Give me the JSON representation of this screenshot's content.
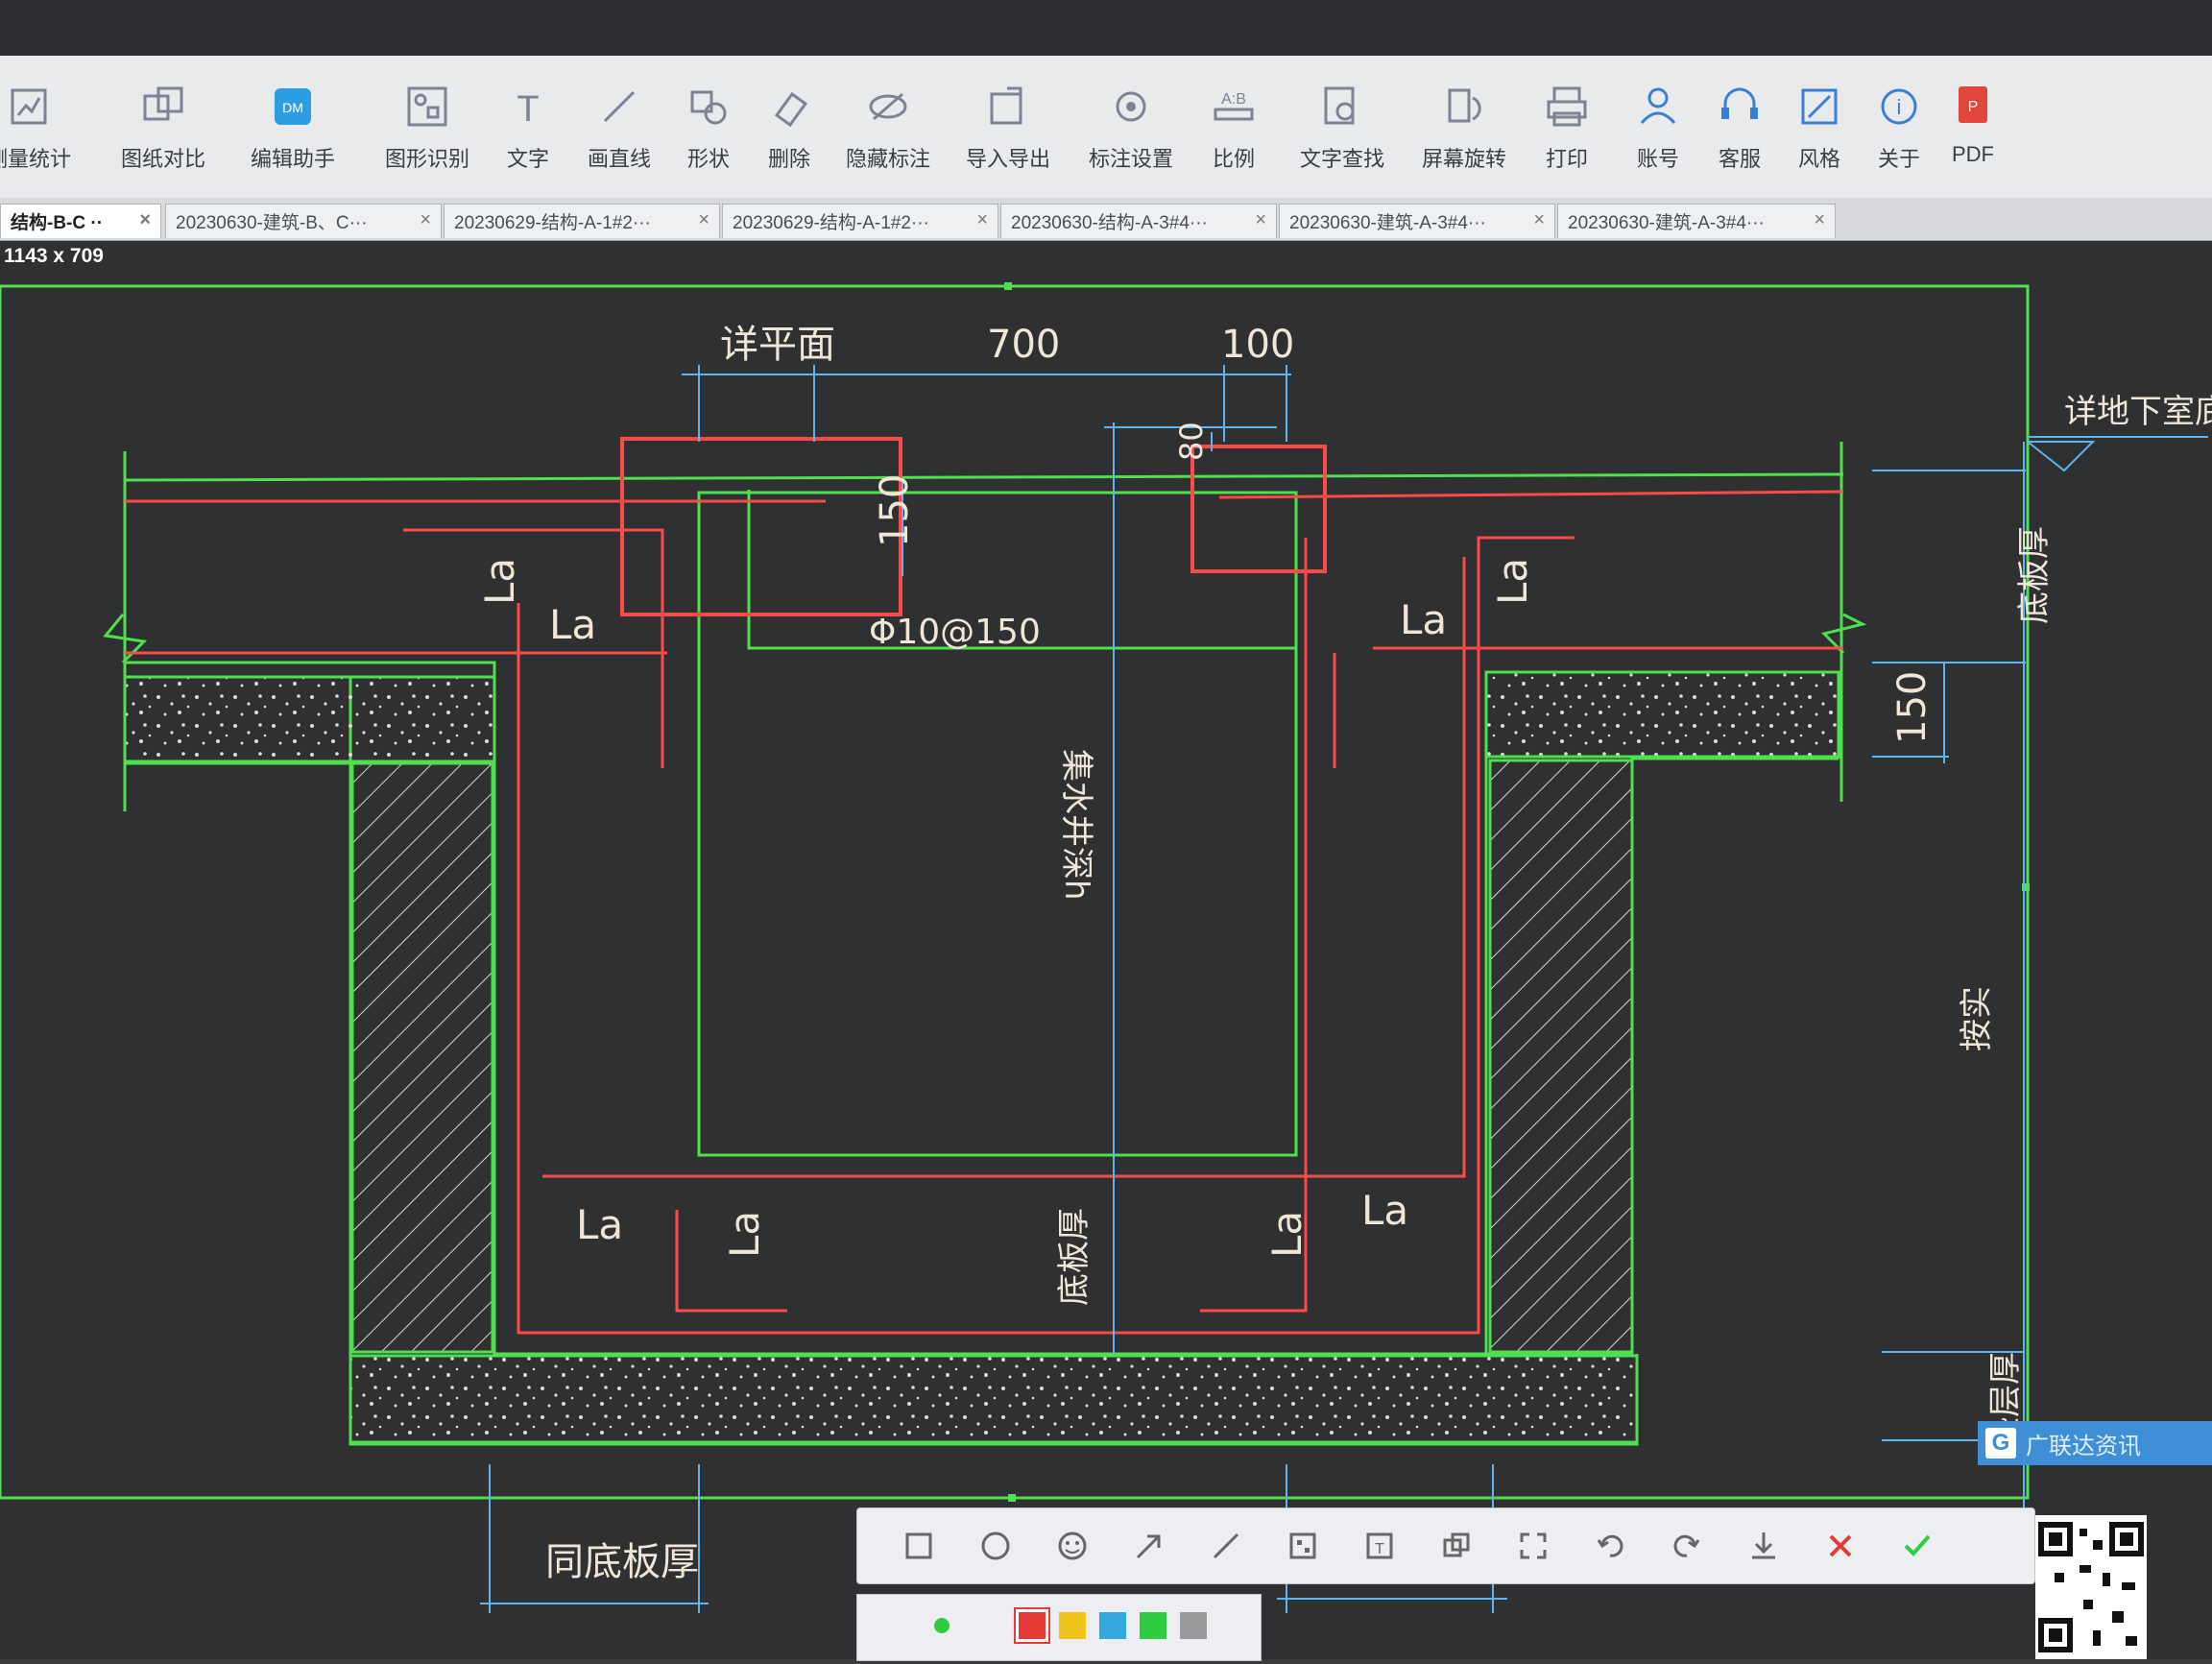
{
  "toolbar": {
    "items": [
      {
        "label": "测量统计",
        "icon": "measure-icon"
      },
      {
        "label": "图纸对比",
        "icon": "compare-icon"
      },
      {
        "label": "编辑助手",
        "icon": "edit-assistant-icon"
      },
      {
        "label": "图形识别",
        "icon": "shape-recognition-icon"
      },
      {
        "label": "文字",
        "icon": "text-icon"
      },
      {
        "label": "画直线",
        "icon": "line-icon"
      },
      {
        "label": "形状",
        "icon": "shape-icon"
      },
      {
        "label": "删除",
        "icon": "eraser-icon"
      },
      {
        "label": "隐藏标注",
        "icon": "hide-annotation-icon"
      },
      {
        "label": "导入导出",
        "icon": "import-export-icon"
      },
      {
        "label": "标注设置",
        "icon": "annotation-settings-icon"
      },
      {
        "label": "比例",
        "icon": "scale-icon"
      },
      {
        "label": "文字查找",
        "icon": "text-search-icon"
      },
      {
        "label": "屏幕旋转",
        "icon": "rotate-screen-icon"
      },
      {
        "label": "打印",
        "icon": "print-icon"
      },
      {
        "label": "账号",
        "icon": "account-icon"
      },
      {
        "label": "客服",
        "icon": "headset-icon"
      },
      {
        "label": "风格",
        "icon": "style-icon"
      },
      {
        "label": "关于",
        "icon": "info-icon"
      },
      {
        "label": "PDF",
        "icon": "pdf-icon"
      }
    ]
  },
  "tabs": [
    {
      "label": "结构-B-C ··",
      "active": true
    },
    {
      "label": "20230630-建筑-B、C···"
    },
    {
      "label": "20230629-结构-A-1#2···"
    },
    {
      "label": "20230629-结构-A-1#2···"
    },
    {
      "label": "20230630-结构-A-3#4···"
    },
    {
      "label": "20230630-建筑-A-3#4···"
    },
    {
      "label": "20230630-建筑-A-3#4···"
    }
  ],
  "tab_close": "×",
  "canvas": {
    "selection_size": "1143 x 709"
  },
  "drawing": {
    "labels": {
      "detail_plan": "详平面",
      "dim_700": "700",
      "dim_100": "100",
      "dim_80": "80",
      "dim_150_left": "150",
      "dim_150_right": "150",
      "basement_slab_detail": "详地下室底板",
      "slab_thickness_right": "底板厚",
      "rebar_spec": "Φ10@150",
      "pit_depth": "集水井深h",
      "as_built": "按实",
      "slab_thickness_bottom": "底板厚",
      "cushion_thickness": "垫层厚",
      "same_slab_thickness": "同底板厚",
      "la": "La"
    }
  },
  "snip_toolbar": {
    "tools": [
      "rectangle-icon",
      "circle-icon",
      "emoji-icon",
      "arrow-icon",
      "pen-icon",
      "mosaic-icon",
      "text-tool-icon",
      "copy-icon",
      "ocr-icon",
      "undo-icon",
      "redo-icon",
      "download-icon",
      "cancel-icon",
      "confirm-icon"
    ]
  },
  "palette": {
    "colors": [
      "#e53935",
      "#f2c319",
      "#35a8e0",
      "#2ecc40",
      "#9a9a9a"
    ]
  },
  "news_popup": {
    "text": "广联达资讯"
  }
}
